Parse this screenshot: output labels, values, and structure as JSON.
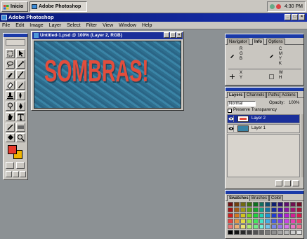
{
  "taskbar": {
    "start_label": "Inicio",
    "task_label": "Adobe Photoshop",
    "clock": "4:30 PM"
  },
  "app": {
    "title": "Adobe Photoshop"
  },
  "menu": [
    "File",
    "Edit",
    "Image",
    "Layer",
    "Select",
    "Filter",
    "View",
    "Window",
    "Help"
  ],
  "document": {
    "title": "Untitled-1.psd @ 100% (Layer 2, RGB)",
    "art_text": "SOMBRAS!"
  },
  "navigator_palette": {
    "tabs": [
      "Navigator",
      "Info",
      "Options"
    ],
    "rgb_labels": "R\nG\nB",
    "cmyk_labels": "C\nM\nY\nK",
    "x_label": "X",
    "y_label": "Y",
    "w_label": "W",
    "h_label": "H"
  },
  "layers_palette": {
    "tabs": [
      "Layers",
      "Channels",
      "Paths",
      "Actions"
    ],
    "blend_mode": "Normal",
    "opacity_label": "Opacity:",
    "opacity_value": "100%",
    "preserve_label": "Preserve Transparency",
    "layers": [
      {
        "name": "Layer 2",
        "active": true
      },
      {
        "name": "Layer 1",
        "active": false
      }
    ]
  },
  "swatches_palette": {
    "tabs": [
      "Swatches",
      "Brushes",
      "Color"
    ]
  },
  "colors": {
    "foreground": "#e83a2c",
    "background": "#f0b400",
    "title_bar": "#1a2f9a",
    "art_text": "#e24d3c"
  },
  "icons": {
    "toolbox": [
      "marquee-icon",
      "move-icon",
      "lasso-icon",
      "magic-wand-icon",
      "airbrush-icon",
      "brush-icon",
      "eraser-icon",
      "pencil-icon",
      "stamp-icon",
      "smudge-icon",
      "dodge-icon",
      "pen-icon",
      "type-icon",
      "line-icon",
      "gradient-icon",
      "bucket-icon",
      "eyedropper-icon",
      "hand-icon",
      "zoom-icon"
    ]
  }
}
